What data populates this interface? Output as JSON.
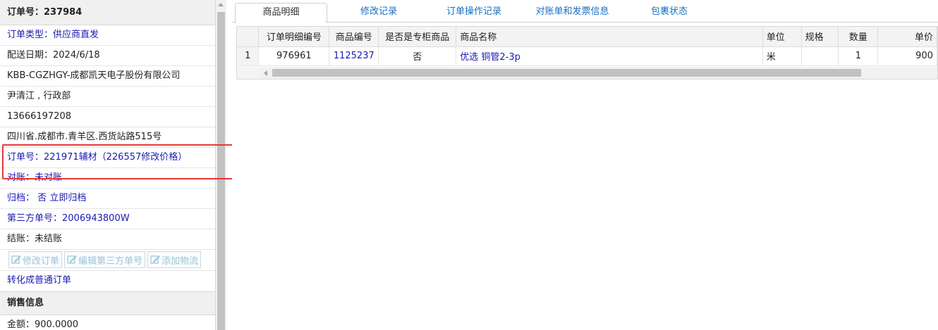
{
  "order": {
    "header": "订单号：237984"
  },
  "left_rows": {
    "order_type_label": "订单类型：",
    "order_type_value": "供应商直发",
    "delivery_date": "配送日期：2024/6/18",
    "customer": "KBB-CGZHGY-成都凯天电子股份有限公司",
    "contact": "尹清江 , 行政部",
    "phone": "13666197208",
    "address": "四川省.成都市.青羊区.西货站路515号",
    "related_order": "订单号：221971辅材（226557修改价格）",
    "reconcile_label": "对账：",
    "reconcile_value": "未对账",
    "archive_label": "归档：",
    "archive_value": "否",
    "archive_link": "立即归档",
    "third_party_label": "第三方单号：",
    "third_party_value": "2006943800W",
    "settle": "结账：未结账",
    "convert_link": "转化成普通订单"
  },
  "buttons": {
    "edit_order": "修改订单",
    "edit_third_party": "编辑第三方单号",
    "add_logistics": "添加物流"
  },
  "sales": {
    "header": "销售信息",
    "amount": "金额：900.0000"
  },
  "tabs": [
    {
      "label": "商品明细",
      "active": true
    },
    {
      "label": "修改记录",
      "active": false
    },
    {
      "label": "订单操作记录",
      "active": false
    },
    {
      "label": "对账单和发票信息",
      "active": false
    },
    {
      "label": "包裹状态",
      "active": false
    }
  ],
  "grid": {
    "columns": [
      "订单明细编号",
      "商品编号",
      "是否是专柜商品",
      "商品名称",
      "单位",
      "规格",
      "数量",
      "单价"
    ],
    "rows": [
      {
        "index": "1",
        "detail_no": "976961",
        "product_no": "1125237",
        "counter": "否",
        "name": "优选 铜管2-3p",
        "unit": "米",
        "spec": "",
        "qty": "1",
        "price": "900"
      }
    ]
  },
  "colors": {
    "link_blue": "#1a1ab0",
    "tab_blue": "#1a6fc0",
    "highlight_red": "#e53935",
    "disabled_button_text": "#9cc4d6"
  },
  "icons": {
    "edit": "edit-icon",
    "scroll_up": "arrow-up-icon",
    "scroll_left": "arrow-left-icon"
  }
}
